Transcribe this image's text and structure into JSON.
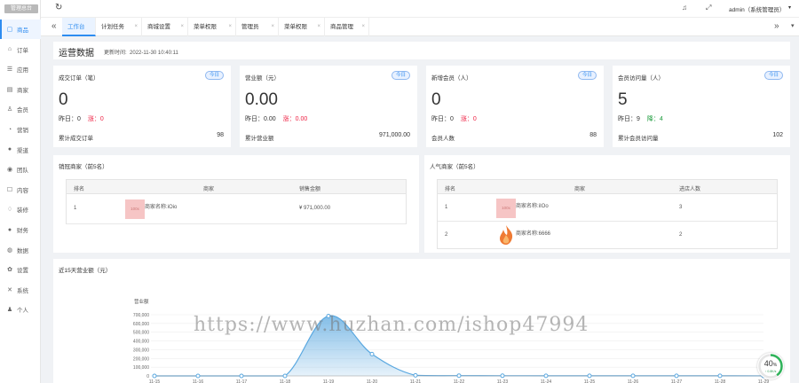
{
  "sidebar": {
    "logo": "管理总台",
    "items": [
      {
        "label": "商品",
        "icon": "bag-icon",
        "glyph": "▢"
      },
      {
        "label": "订单",
        "icon": "receipt-icon",
        "glyph": "⌂"
      },
      {
        "label": "应用",
        "icon": "apps-icon",
        "glyph": "☰"
      },
      {
        "label": "商家",
        "icon": "store-icon",
        "glyph": "▤"
      },
      {
        "label": "会员",
        "icon": "user-icon",
        "glyph": "♙"
      },
      {
        "label": "营销",
        "icon": "marketing-icon",
        "glyph": "◔"
      },
      {
        "label": "渠道",
        "icon": "channel-icon",
        "glyph": "●"
      },
      {
        "label": "团队",
        "icon": "team-icon",
        "glyph": "◉"
      },
      {
        "label": "内容",
        "icon": "content-icon",
        "glyph": "☐"
      },
      {
        "label": "装修",
        "icon": "decorate-icon",
        "glyph": "♢"
      },
      {
        "label": "财务",
        "icon": "finance-icon",
        "glyph": "●"
      },
      {
        "label": "数据",
        "icon": "data-icon",
        "glyph": "◍"
      },
      {
        "label": "设置",
        "icon": "settings-icon",
        "glyph": "✿"
      },
      {
        "label": "系统",
        "icon": "system-icon",
        "glyph": "✕"
      },
      {
        "label": "个人",
        "icon": "person-icon",
        "glyph": "♟"
      }
    ]
  },
  "topbar": {
    "refresh_icon": "↻",
    "bell_icon": "♫",
    "expand_icon": "⤢",
    "user": "admin（系统管理员）",
    "caret": "▾"
  },
  "tabs": [
    {
      "label": "工作台"
    },
    {
      "label": "计划任务"
    },
    {
      "label": "商城设置"
    },
    {
      "label": "菜单权限"
    },
    {
      "label": "管理员"
    },
    {
      "label": "菜单权限"
    },
    {
      "label": "商品管理"
    }
  ],
  "tabbar": {
    "prev": "«",
    "next": "»",
    "more": "▾"
  },
  "overview": {
    "title": "运营数据",
    "updated_label": "更新时间:",
    "updated_time": "2022-11-30 10:40:11"
  },
  "cards": [
    {
      "title": "成交订单（笔）",
      "badge": "今日",
      "value": "0",
      "yesterday_label": "昨日：",
      "yesterday": "0",
      "change_label": "涨：",
      "change": "0",
      "change_kind": "drop",
      "total_label": "累计成交订单",
      "total": "98"
    },
    {
      "title": "营业额（元）",
      "badge": "今日",
      "value": "0.00",
      "yesterday_label": "昨日：",
      "yesterday": "0.00",
      "change_label": "涨：",
      "change": "0.00",
      "change_kind": "drop",
      "total_label": "累计营业额",
      "total": "971,000.00"
    },
    {
      "title": "新增会员（人）",
      "badge": "今日",
      "value": "0",
      "yesterday_label": "昨日：",
      "yesterday": "0",
      "change_label": "涨：",
      "change": "0",
      "change_kind": "drop",
      "total_label": "会员人数",
      "total": "88"
    },
    {
      "title": "会员访问量（人）",
      "badge": "今日",
      "value": "5",
      "yesterday_label": "昨日：",
      "yesterday": "9",
      "change_label": "降：",
      "change": "4",
      "change_kind": "rise",
      "total_label": "累计会员访问量",
      "total": "102"
    }
  ],
  "sales_rank": {
    "title": "销冠商家（前5名）",
    "headers": [
      "排名",
      "商家",
      "销售金额"
    ],
    "rows": [
      {
        "rank": "1",
        "thumb": "100x",
        "name": "商家名称:iOio",
        "amount": "¥ 971,000.00"
      }
    ]
  },
  "popular_rank": {
    "title": "人气商家（前5名）",
    "headers": [
      "排名",
      "商家",
      "进店人数"
    ],
    "rows": [
      {
        "rank": "1",
        "thumb": "100x",
        "name": "商家名称:iIOo",
        "count": "3"
      },
      {
        "rank": "2",
        "thumb": "flame",
        "name": "商家名称:6666",
        "count": "2"
      }
    ]
  },
  "revenue_chart": {
    "title": "近15天营业额（元）"
  },
  "chart_data": {
    "type": "area",
    "ylabel": "营业额",
    "x": [
      "11-15",
      "11-16",
      "11-17",
      "11-18",
      "11-19",
      "11-20",
      "11-21",
      "11-22",
      "11-23",
      "11-24",
      "11-25",
      "11-26",
      "11-27",
      "11-28",
      "11-29"
    ],
    "values": [
      0,
      0,
      0,
      0,
      685000,
      250000,
      6000,
      3000,
      2000,
      1500,
      1500,
      1000,
      1000,
      1000,
      500
    ],
    "yticks": [
      "700,000",
      "600,000",
      "500,000",
      "400,000",
      "300,000",
      "200,000",
      "100,000",
      "0"
    ],
    "ylim": [
      0,
      700000
    ],
    "color": "#5aa8e0"
  },
  "watermark": "https://www.huzhan.com/ishop47994",
  "progress_widget": {
    "value": "40",
    "unit": "%",
    "sub": "↑ 0.8K/s",
    "fraction": 0.4
  }
}
